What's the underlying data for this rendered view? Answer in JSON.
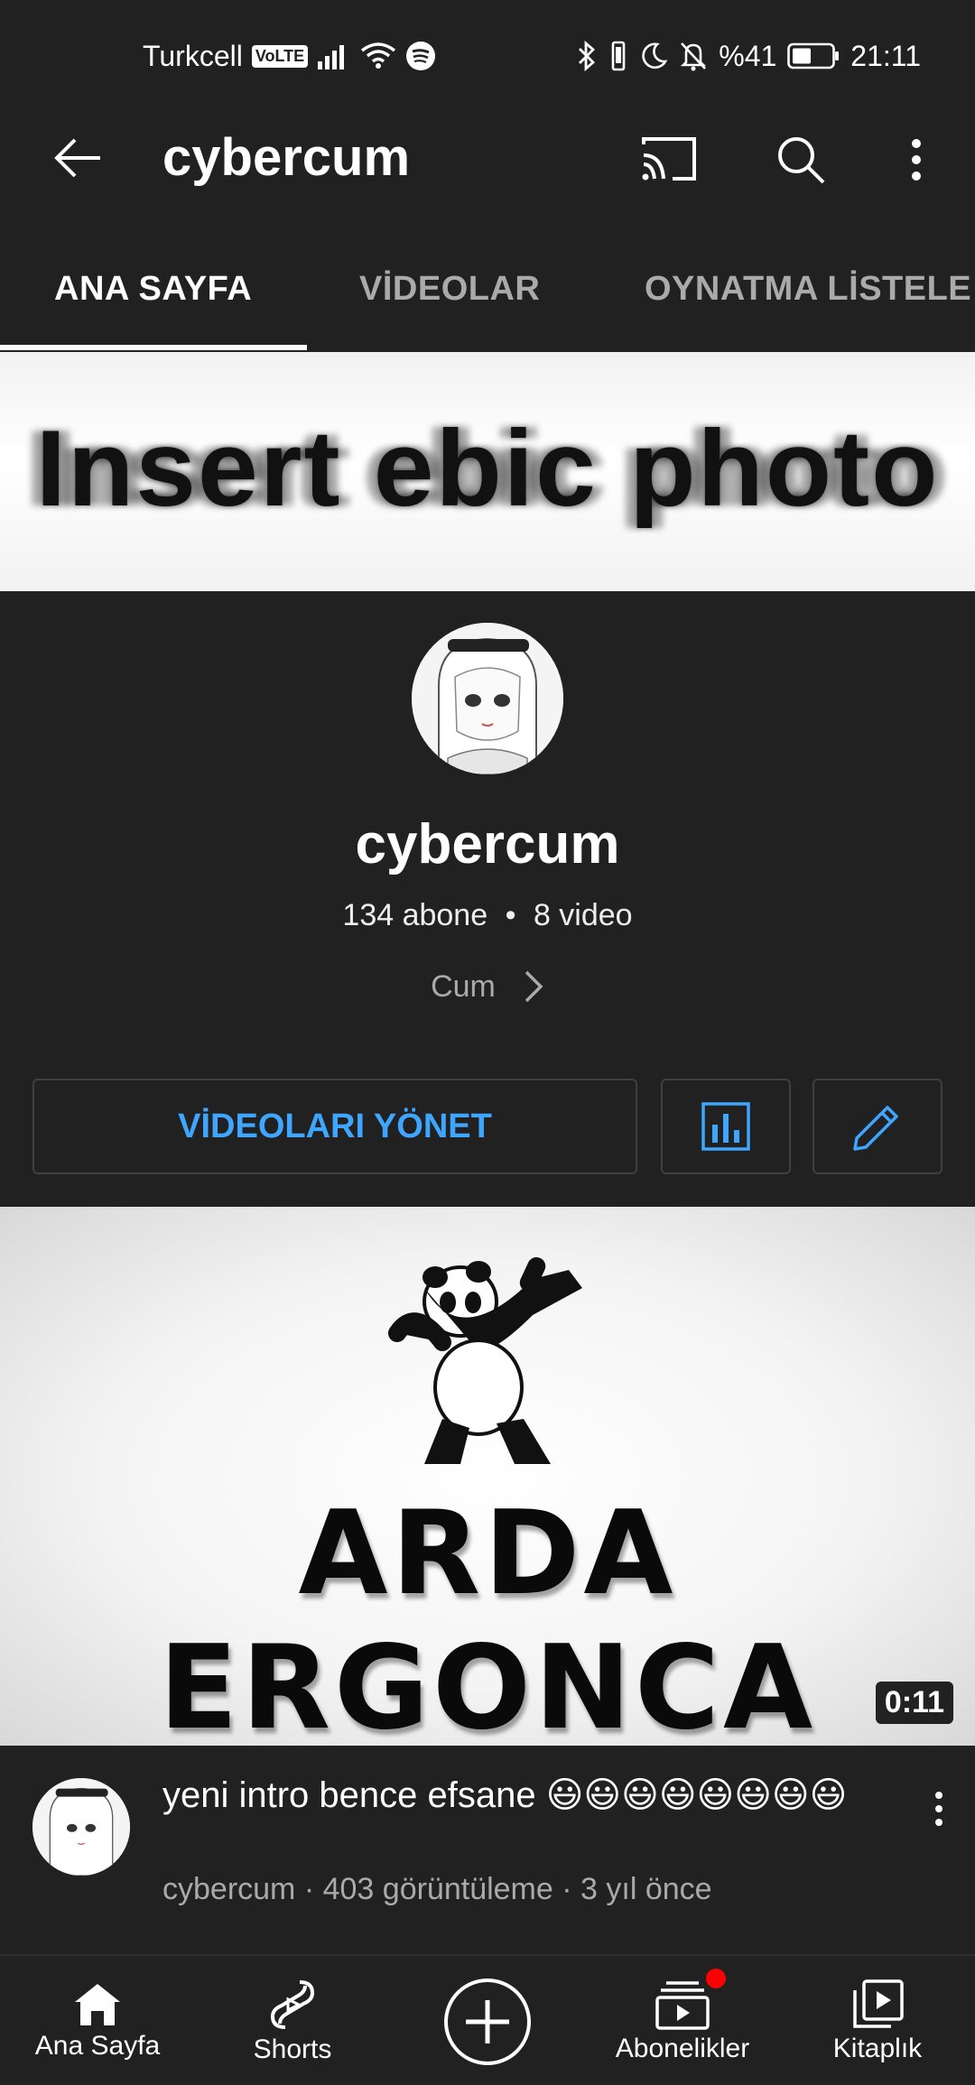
{
  "status_bar": {
    "carrier": "Turkcell",
    "volte": "VoLTE",
    "battery_text": "%41",
    "time": "21:11"
  },
  "app_bar": {
    "title": "cybercum"
  },
  "tabs": [
    {
      "label": "ANA SAYFA",
      "active": true
    },
    {
      "label": "VİDEOLAR",
      "active": false
    },
    {
      "label": "OYNATMA LİSTELE",
      "active": false
    }
  ],
  "banner": {
    "text": "Insert ebic photo"
  },
  "channel": {
    "name": "cybercum",
    "subscribers": "134 abone",
    "videos": "8 video",
    "separator": "•",
    "description": "Cum"
  },
  "actions": {
    "manage_videos": "VİDEOLARI YÖNET"
  },
  "featured_video": {
    "thumbnail_text": "ARDA ERGONCA",
    "duration": "0:11",
    "title": "yeni intro bence efsane 😃😃😃😃😃😃😃😃",
    "channel": "cybercum",
    "views": "403 görüntüleme",
    "age": "3 yıl önce",
    "meta_separator": "·"
  },
  "bottom_nav": [
    {
      "label": "Ana Sayfa",
      "icon": "home-icon"
    },
    {
      "label": "Shorts",
      "icon": "shorts-icon"
    },
    {
      "label": "",
      "icon": "create-icon"
    },
    {
      "label": "Abonelikler",
      "icon": "subscriptions-icon"
    },
    {
      "label": "Kitaplık",
      "icon": "library-icon"
    }
  ],
  "colors": {
    "background": "#212121",
    "accent_blue": "#3ea6ff",
    "notification_red": "#ff0000"
  }
}
